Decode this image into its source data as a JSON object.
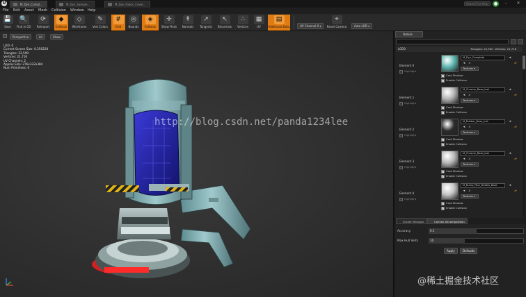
{
  "window": {
    "tabs": [
      "M_Dyn_Compl...",
      "M_Dyn_Sample...",
      "M_Dyn_Fabric_Cover..."
    ],
    "search_placeholder": "Search For Help",
    "min": "–",
    "close": "✕"
  },
  "menu": [
    "File",
    "Edit",
    "Asset",
    "Mesh",
    "Collision",
    "Window",
    "Help"
  ],
  "toolbar": {
    "buttons": [
      {
        "label": "Save",
        "icon": "save-icon",
        "glyph": "💾",
        "on": false
      },
      {
        "label": "Find in CB",
        "icon": "find-icon",
        "glyph": "🔍",
        "on": false
      },
      {
        "label": "Reimport",
        "icon": "reimport-icon",
        "glyph": "⟳",
        "on": false
      },
      {
        "label": "Collision",
        "icon": "collision-icon",
        "glyph": "◆",
        "on": true
      },
      {
        "label": "Wireframe",
        "icon": "wireframe-icon",
        "glyph": "◇",
        "on": false
      },
      {
        "label": "Vert Colors",
        "icon": "brush-icon",
        "glyph": "✎",
        "on": false
      },
      {
        "label": "Grid",
        "icon": "grid-icon",
        "glyph": "#",
        "on": true
      },
      {
        "label": "Bounds",
        "icon": "bounds-icon",
        "glyph": "◎",
        "on": false
      },
      {
        "label": "Collision",
        "icon": "collision-icon",
        "glyph": "◈",
        "on": true
      },
      {
        "label": "Show Pivot",
        "icon": "pivot-icon",
        "glyph": "✛",
        "on": false
      },
      {
        "label": "Normals",
        "icon": "normals-icon",
        "glyph": "↟",
        "on": false
      },
      {
        "label": "Tangents",
        "icon": "tangents-icon",
        "glyph": "↗",
        "on": false
      },
      {
        "label": "Binormals",
        "icon": "binormals-icon",
        "glyph": "↖",
        "on": false
      },
      {
        "label": "Vertices",
        "icon": "vertices-icon",
        "glyph": "∴",
        "on": false
      },
      {
        "label": "UV",
        "icon": "uv-icon",
        "glyph": "▦",
        "on": false
      },
      {
        "label": "Additional Data",
        "icon": "data-icon",
        "glyph": "▤",
        "on": true
      },
      {
        "label": "Reset Camera",
        "icon": "camera-icon",
        "glyph": "⌖",
        "on": false
      }
    ],
    "uv_channel": "UV Channel 0 ▾",
    "auto_lod": "Auto LOD ▾"
  },
  "viewport": {
    "perspective": "Perspective",
    "lit": "Lit",
    "show": "Show",
    "stats": [
      "LOD: 0",
      "Current Screen Size: 0.250228",
      "Triangles: 22,590",
      "Vertices: 21,716",
      "UV Channels: 2",
      "Approx Size: 276x322x384",
      "Num Primitives: 0"
    ],
    "watermark": "http://blog.csdn.net/panda1234lee",
    "watermark2": "@稀土掘金技术社区"
  },
  "details": {
    "tab": "Details",
    "lod_label": "LOD0",
    "triangles": "Triangles: 22,590",
    "vertices": "Vertices: 21,716",
    "elements": [
      {
        "name": "Element 0",
        "material": "M_Dyn_Complete",
        "thumb": "#5fb7b0",
        "opts": [
          "Cast Shadow",
          "Enable Collision"
        ]
      },
      {
        "name": "Element 1",
        "material": "M_Chrome_Base_Inst",
        "thumb": "#b5b5b5",
        "opts": [
          "Cast Shadow",
          "Enable Collision"
        ]
      },
      {
        "name": "Element 2",
        "material": "M_Rubber_Base_Inst",
        "thumb": "#2a2a2a",
        "opts": [
          "Cast Shadow",
          "Enable Collision"
        ]
      },
      {
        "name": "Element 3",
        "material": "M_Chrome_Base_Inst",
        "thumb": "#b9b9b9",
        "opts": [
          "Cast Shadow",
          "Enable Collision"
        ]
      },
      {
        "name": "Element 4",
        "material": "M_Bump_Pipe_Details_Base",
        "thumb": "#c4c4c4",
        "opts": [
          "Cast Shadow",
          "Enable Collision"
        ]
      }
    ],
    "highlight": "Highlight",
    "textures": "Textures ▾"
  },
  "bottom": {
    "tabs": [
      "Socket Manager",
      "Convex Decomposition"
    ],
    "accuracy_label": "Accuracy",
    "accuracy_value": "0.5",
    "accuracy_fraction": 0.5,
    "maxverts_label": "Max Hull Verts",
    "maxverts_value": "16",
    "apply": "Apply",
    "defaults": "Defaults"
  }
}
